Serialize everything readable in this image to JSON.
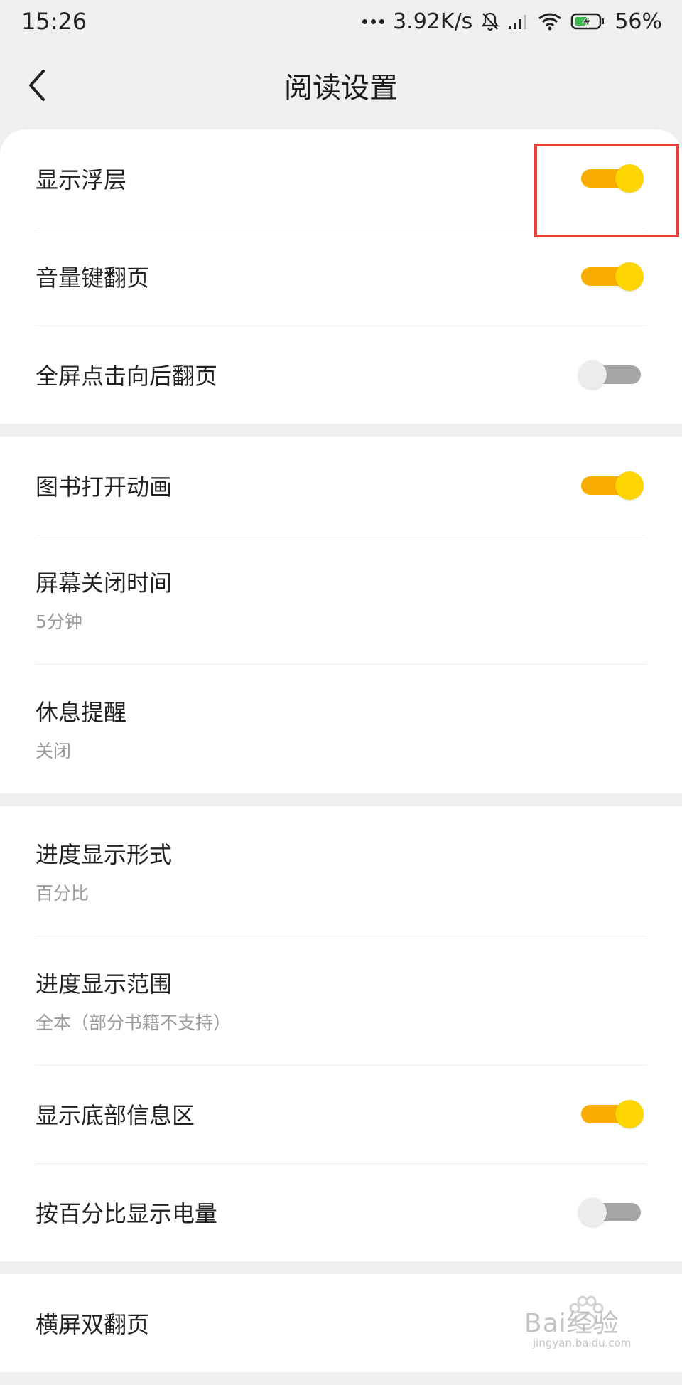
{
  "status_bar": {
    "time": "15:26",
    "network_speed": "3.92K/s",
    "battery": "56%"
  },
  "header": {
    "title": "阅读设置"
  },
  "sections": [
    {
      "items": [
        {
          "label": "显示浮层",
          "toggle": "on"
        },
        {
          "label": "音量键翻页",
          "toggle": "on"
        },
        {
          "label": "全屏点击向后翻页",
          "toggle": "off"
        }
      ]
    },
    {
      "items": [
        {
          "label": "图书打开动画",
          "toggle": "on"
        },
        {
          "label": "屏幕关闭时间",
          "subtitle": "5分钟"
        },
        {
          "label": "休息提醒",
          "subtitle": "关闭"
        }
      ]
    },
    {
      "items": [
        {
          "label": "进度显示形式",
          "subtitle": "百分比"
        },
        {
          "label": "进度显示范围",
          "subtitle": "全本（部分书籍不支持）"
        },
        {
          "label": "显示底部信息区",
          "toggle": "on"
        },
        {
          "label": "按百分比显示电量",
          "toggle": "off"
        }
      ]
    },
    {
      "items": [
        {
          "label": "横屏双翻页"
        }
      ]
    }
  ],
  "colors": {
    "accent_track": "#f8ad00",
    "accent_knob": "#fdd500",
    "highlight": "#ee3a3a"
  },
  "watermark": {
    "text": "Bai经验",
    "subtext": "jingyan.baidu.com"
  }
}
